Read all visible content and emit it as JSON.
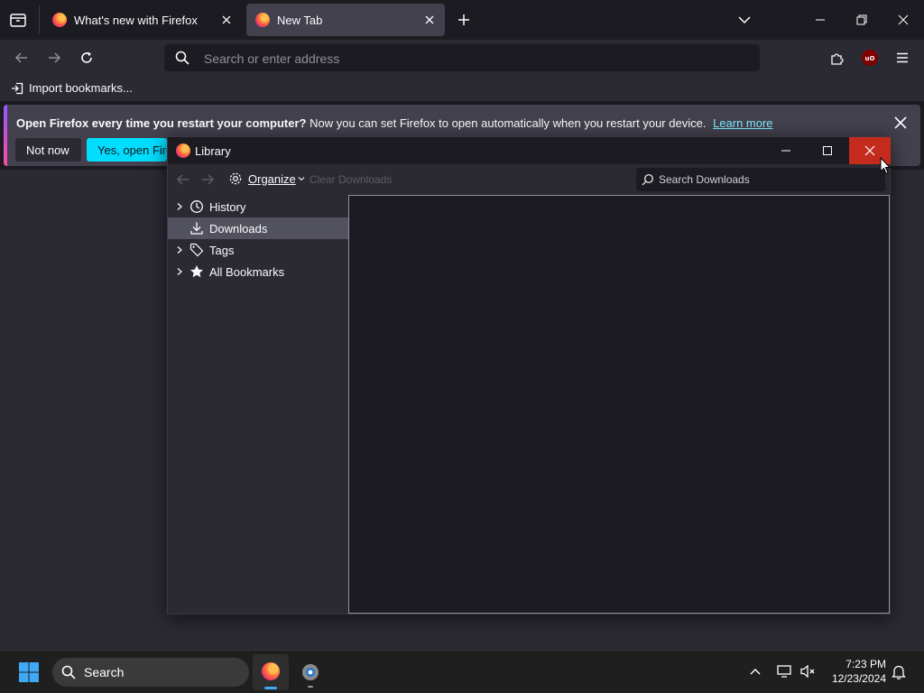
{
  "tabs": [
    {
      "title": "What's new with Firefox",
      "active": false
    },
    {
      "title": "New Tab",
      "active": true
    }
  ],
  "navbar": {
    "placeholder": "Search or enter address"
  },
  "bookmarks_bar": {
    "import_label": "Import bookmarks..."
  },
  "notification": {
    "bold_text": "Open Firefox every time you restart your computer?",
    "text": "Now you can set Firefox to open automatically when you restart your device.",
    "link": "Learn more",
    "not_now": "Not now",
    "yes_open": "Yes, open Firefox"
  },
  "library": {
    "title": "Library",
    "organize_label": "Organize",
    "clear_label": "Clear Downloads",
    "search_placeholder": "Search Downloads",
    "tree": [
      {
        "label": "History",
        "expandable": true,
        "icon": "clock-icon",
        "selected": false
      },
      {
        "label": "Downloads",
        "expandable": false,
        "icon": "download-icon",
        "selected": true
      },
      {
        "label": "Tags",
        "expandable": true,
        "icon": "tag-icon",
        "selected": false
      },
      {
        "label": "All Bookmarks",
        "expandable": true,
        "icon": "star-icon",
        "selected": false
      }
    ]
  },
  "taskbar": {
    "search_label": "Search",
    "time": "7:23 PM",
    "date": "12/23/2024"
  },
  "colors": {
    "accent": "#00ddff",
    "close_red": "#c42b1c",
    "link": "#80ebff"
  }
}
